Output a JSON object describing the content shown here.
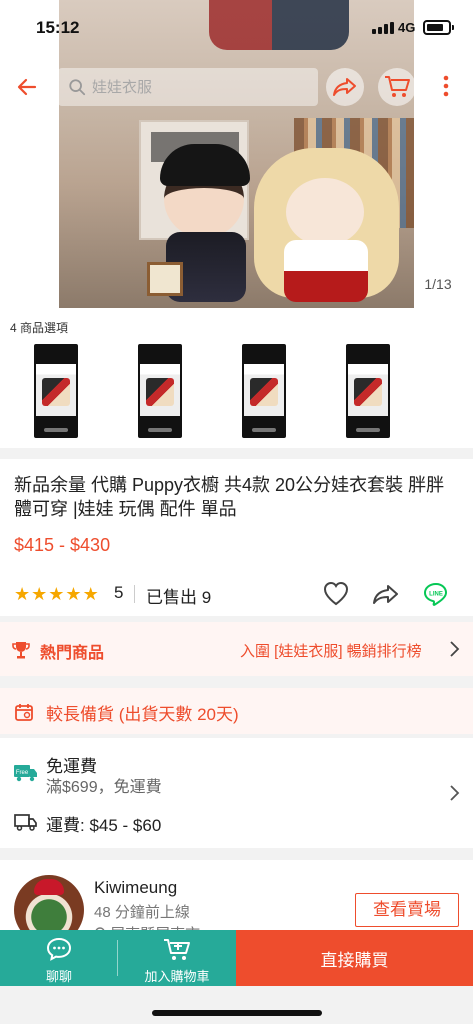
{
  "status_bar": {
    "time": "15:12",
    "network": "4G"
  },
  "nav": {
    "search_placeholder": "娃娃衣服"
  },
  "gallery": {
    "counter": "1/13"
  },
  "options": {
    "label": "4 商品選項",
    "count": 4
  },
  "product": {
    "title": "新品余量 代購 Puppy衣櫥 共4款  20公分娃衣套裝 胖胖體可穿 |娃娃 玩偶 配件 單品",
    "price": "$415 - $430",
    "rating": "5",
    "rating_fraction": 1.0,
    "sold": "已售出 9"
  },
  "hot": {
    "label": "熱門商品",
    "link": "入圍 [娃娃衣服] 暢銷排行榜"
  },
  "backorder": {
    "text": "較長備貨 (出貨天數 20天)"
  },
  "shipping": {
    "free_badge": "Free",
    "free_title": "免運費",
    "free_condition": "滿$699，免運費",
    "fee": "運費: $45 - $60"
  },
  "seller": {
    "name": "Kiwimeung",
    "online": "48 分鐘前上線",
    "location": "屏東縣屏東市"
  },
  "bottom_bar": {
    "chat": "聊聊",
    "add_to_cart": "加入購物車",
    "buy_now": "直接購買",
    "visit_shop": "查看賣場"
  },
  "colors": {
    "primary": "#ee4d2d",
    "teal": "#26aa99",
    "star": "#f6a700",
    "line": "#06c755"
  }
}
